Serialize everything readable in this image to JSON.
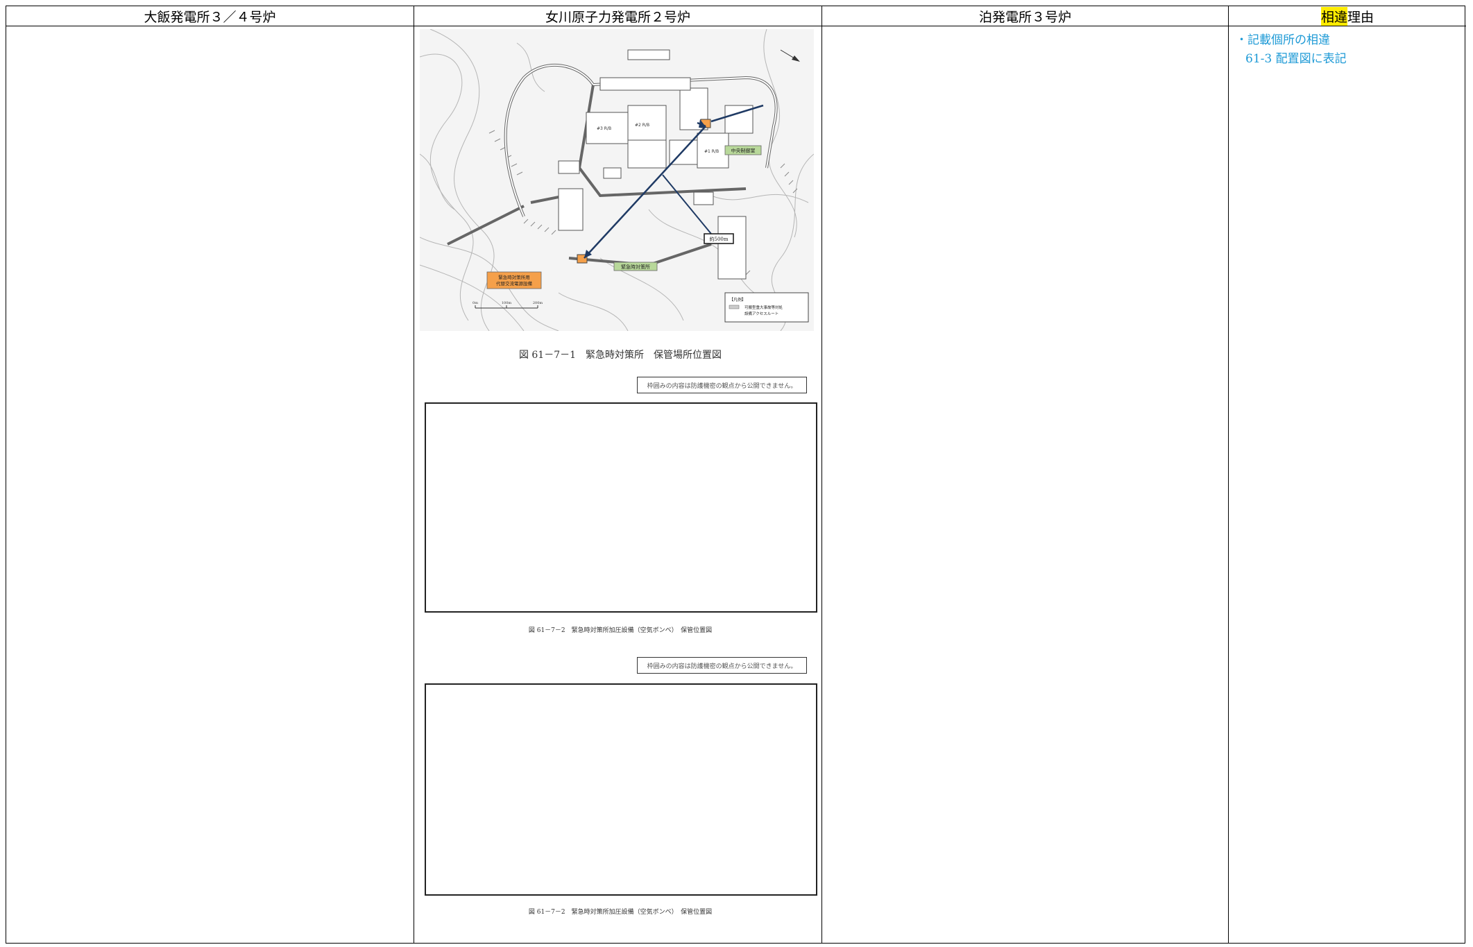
{
  "columns": {
    "ohi": "大飯発電所３／４号炉",
    "onagawa": "女川原子力発電所２号炉",
    "tomari": "泊発電所３号炉",
    "reason_highlight": "相違",
    "reason_suffix": "理由"
  },
  "reasons": [
    "・記載個所の相違",
    "61-3 配置図に表記"
  ],
  "figures": {
    "fig1_caption": "図 61－7－1　緊急時対策所　保管場所位置図",
    "fig2_caption": "図 61－7－2　緊急時対策所加圧設備（空気ボンベ）　保管位置図",
    "fig3_caption": "図 61－7－2　緊急時対策所加圧設備（空気ボンベ）　保管位置図",
    "notice": "枠囲みの内容は防護機密の観点から公開できません。"
  },
  "map_labels": {
    "central_control": "中央制御室",
    "emergency_office": "緊急時対策所",
    "storage": "緊急時対策所用",
    "storage2": "代替交流電源設備",
    "distance": "約500m",
    "legend_title": "【凡例】",
    "legend_item": "可搬型重大事故等対処",
    "legend_item2": "設備アクセスルート",
    "r1": "#1 R/B",
    "r2": "#2 R/B",
    "r3": "#3 R/B",
    "scale0": "0m",
    "scale1": "100m",
    "scale2": "200m"
  },
  "colors": {
    "reason_text": "#1e9ad6",
    "highlight": "#ffeb00",
    "storage_box": "#f5a04a",
    "label_green": "#b8d89a",
    "arrow": "#1f3a64"
  }
}
